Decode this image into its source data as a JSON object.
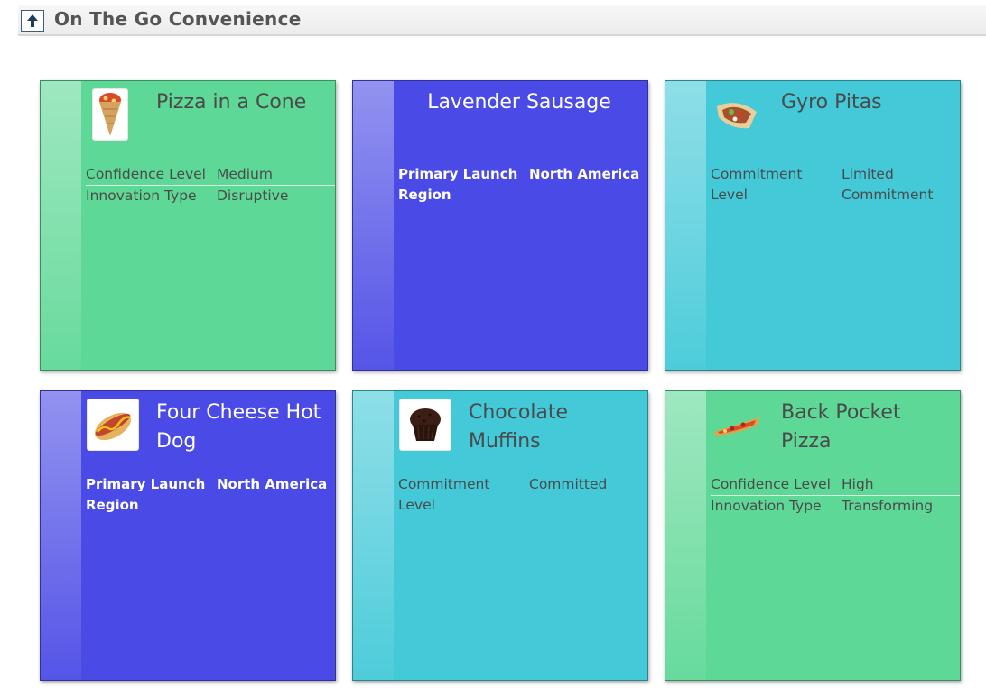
{
  "header": {
    "title": "On The Go Convenience",
    "up_icon": "up-arrow-icon"
  },
  "colors": {
    "green": "#5ed896",
    "blue": "#4a4ae6",
    "cyan": "#43c9d8"
  },
  "cards": [
    {
      "name": "Pizza in a Cone",
      "color": "green",
      "icon": "pizza-cone-icon",
      "fields": [
        {
          "label": "Confidence Level",
          "value": "Medium"
        },
        {
          "label": "Innovation Type",
          "value": "Disruptive"
        }
      ]
    },
    {
      "name": "Lavender Sausage",
      "color": "blue",
      "icon": "",
      "fields": [
        {
          "label": "Primary Launch Region",
          "value": "North America"
        }
      ]
    },
    {
      "name": "Gyro Pitas",
      "color": "cyan",
      "icon": "gyro-icon",
      "fields": [
        {
          "label": "Commitment Level",
          "value": "Limited Commitment"
        }
      ]
    },
    {
      "name": "Four Cheese Hot Dog",
      "color": "blue",
      "icon": "hot-dog-icon",
      "fields": [
        {
          "label": "Primary Launch Region",
          "value": "North America"
        }
      ]
    },
    {
      "name": "Chocolate Muffins",
      "color": "cyan",
      "icon": "muffin-icon",
      "fields": [
        {
          "label": "Commitment Level",
          "value": "Committed"
        }
      ]
    },
    {
      "name": "Back Pocket Pizza",
      "color": "green",
      "icon": "pizza-slice-icon",
      "fields": [
        {
          "label": "Confidence Level",
          "value": "High"
        },
        {
          "label": "Innovation Type",
          "value": "Transforming"
        }
      ]
    }
  ]
}
